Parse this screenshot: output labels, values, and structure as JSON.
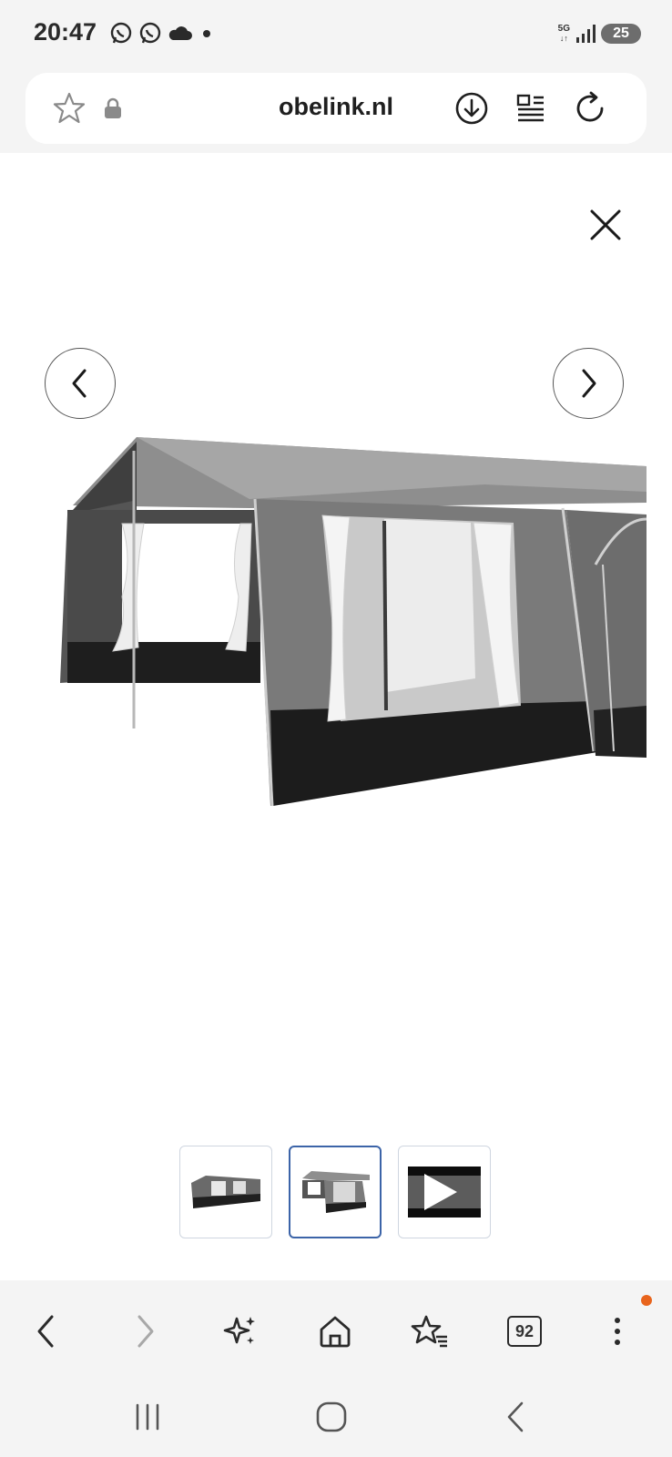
{
  "status_bar": {
    "time": "20:47",
    "network": "5G",
    "battery": "25",
    "icons_left": [
      "whatsapp-icon",
      "whatsapp-icon",
      "cloud-icon",
      "dot-icon"
    ],
    "icons_right": [
      "5g-icon",
      "signal-icon",
      "battery-icon"
    ]
  },
  "url_bar": {
    "domain": "obelink.nl",
    "icons": [
      "star-icon",
      "lock-icon",
      "download-icon",
      "reader-mode-icon",
      "reload-icon"
    ]
  },
  "viewer": {
    "icons": [
      "close-icon",
      "chevron-left-icon",
      "chevron-right-icon"
    ],
    "thumbnails": [
      {
        "name": "thumbnail-1",
        "active": false
      },
      {
        "name": "thumbnail-2",
        "active": true
      },
      {
        "name": "thumbnail-3-video",
        "active": false
      }
    ]
  },
  "toolbar": {
    "tab_count": "92",
    "icons": [
      "back-icon",
      "forward-icon",
      "sparkle-icon",
      "home-icon",
      "bookmarks-icon",
      "tabs-icon",
      "menu-icon"
    ],
    "notification_color": "#e8641c"
  },
  "system_nav": {
    "icons": [
      "recents-icon",
      "home-circle-icon",
      "back-icon"
    ]
  },
  "colors": {
    "chrome_bg": "#f4f4f4",
    "active_thumb_border": "#3c64a8"
  }
}
